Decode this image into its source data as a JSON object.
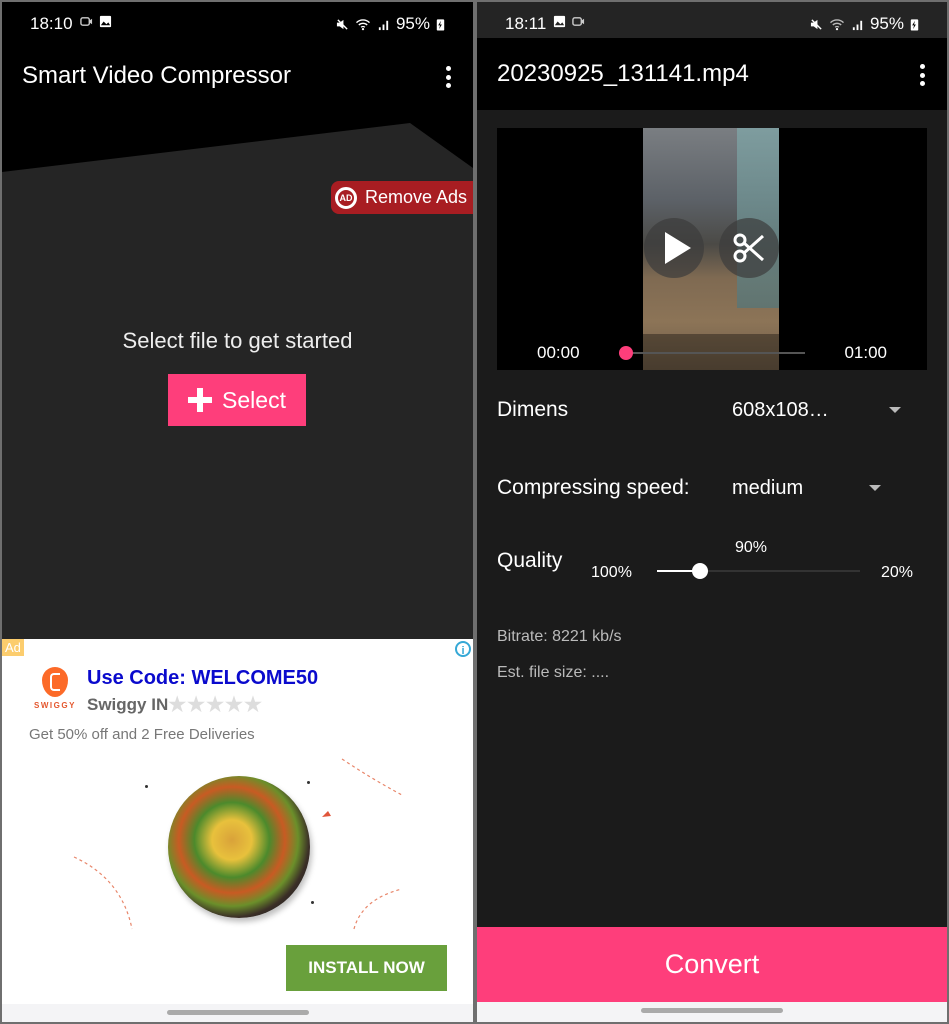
{
  "left_screen": {
    "status_bar": {
      "time": "18:10",
      "battery": "95%",
      "icons_left": [
        "screen-record-icon",
        "image-icon"
      ],
      "icons_right": [
        "mute-icon",
        "wifi-icon",
        "signal-icon",
        "battery-charging-icon"
      ]
    },
    "app_bar": {
      "title": "Smart Video Compressor",
      "menu_icon": "more-vert-icon"
    },
    "remove_ads": {
      "label": "Remove Ads",
      "icon": "ad-block-icon",
      "icon_text": "AD",
      "color": "#a81d22"
    },
    "prompt": "Select file to get started",
    "select_button": {
      "label": "Select",
      "icon": "plus-icon",
      "color": "#fe3e7b"
    },
    "ad": {
      "tag": "Ad",
      "info_icon": "info-icon",
      "brand_logo_text": "SWIGGY",
      "headline": "Use Code: WELCOME50",
      "advertiser": "Swiggy IN",
      "rating_stars": 0,
      "rating_max": 5,
      "star_glyphs": "★★★★★",
      "description": "Get 50% off and 2 Free Deliveries",
      "cta": "INSTALL NOW",
      "cta_color": "#69a03c"
    }
  },
  "right_screen": {
    "status_bar": {
      "time": "18:11",
      "battery": "95%",
      "icons_left": [
        "image-icon",
        "screen-record-icon"
      ],
      "icons_right": [
        "mute-icon",
        "wifi-icon",
        "signal-icon",
        "battery-charging-icon"
      ]
    },
    "app_bar": {
      "title": "20230925_131141.mp4",
      "menu_icon": "more-vert-icon"
    },
    "player": {
      "current_time": "00:00",
      "duration": "01:00",
      "progress": 0,
      "play_icon": "play-icon",
      "trim_icon": "scissors-icon"
    },
    "dimens": {
      "label": "Dimens",
      "value": "608x108…"
    },
    "speed": {
      "label": "Compressing speed:",
      "value": "medium"
    },
    "quality": {
      "label": "Quality",
      "min_label": "100%",
      "max_label": "20%",
      "current_label": "90%",
      "value_percent": 90,
      "range": [
        100,
        20
      ]
    },
    "bitrate": "Bitrate: 8221 kb/s",
    "est_size": "Est. file size: ....",
    "convert_button": {
      "label": "Convert",
      "color": "#fe3e7b"
    }
  }
}
